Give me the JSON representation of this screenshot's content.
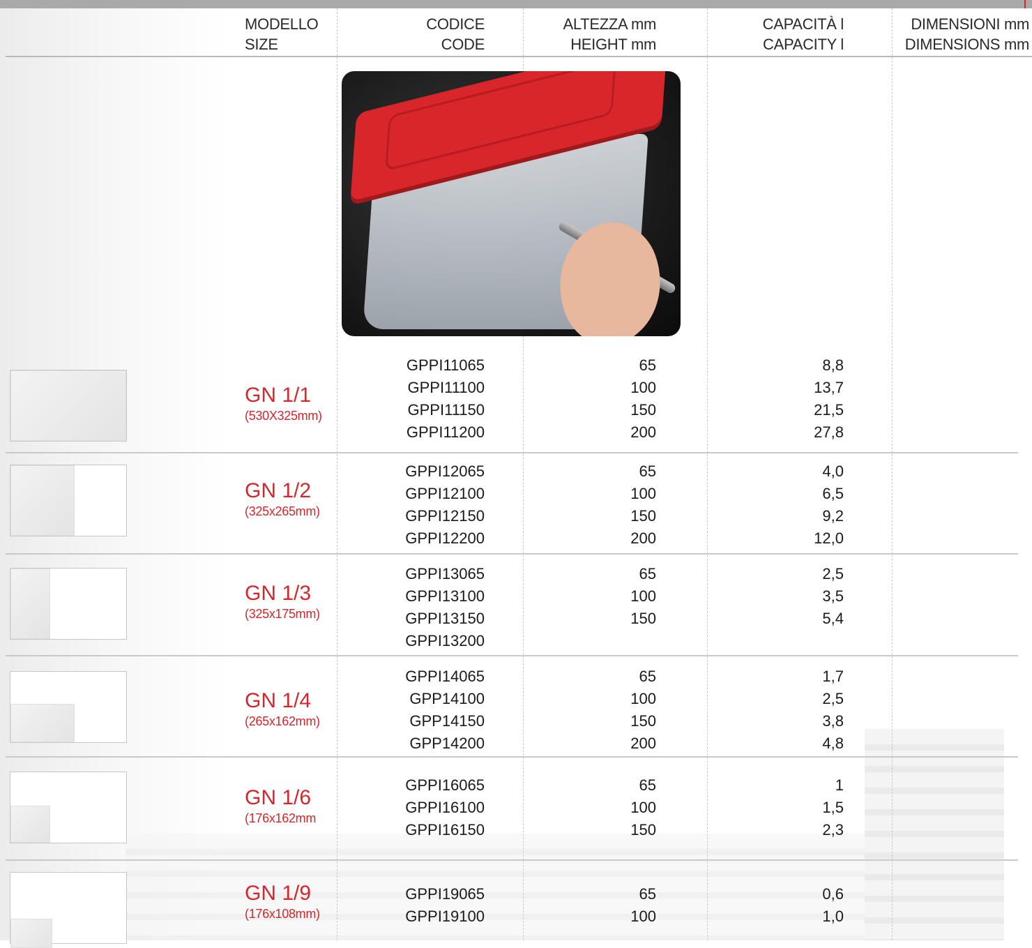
{
  "header": {
    "model": [
      "MODELLO",
      "SIZE"
    ],
    "code": [
      "CODICE",
      "CODE"
    ],
    "height": [
      "ALTEZZA mm",
      "HEIGHT mm"
    ],
    "capacity": [
      "CAPACITÀ l",
      "CAPACITY l"
    ],
    "dimensions": [
      "DIMENSIONI mm",
      "DIMENSIONS mm"
    ]
  },
  "rows": [
    {
      "name": "GN 1/1",
      "dim": "(530X325mm)",
      "codes": [
        "GPPI11065",
        "GPPI11100",
        "GPPI11150",
        "GPPI11200"
      ],
      "heights": [
        "65",
        "100",
        "150",
        "200"
      ],
      "capacities": [
        "8,8",
        "13,7",
        "21,5",
        "27,8"
      ]
    },
    {
      "name": "GN 1/2",
      "dim": "(325x265mm)",
      "codes": [
        "GPPI12065",
        "GPPI12100",
        "GPPI12150",
        "GPPI12200"
      ],
      "heights": [
        "65",
        "100",
        "150",
        "200"
      ],
      "capacities": [
        "4,0",
        "6,5",
        "9,2",
        "12,0"
      ]
    },
    {
      "name": "GN 1/3",
      "dim": "(325x175mm)",
      "codes": [
        "GPPI13065",
        "GPPI13100",
        "GPPI13150",
        "GPPI13200"
      ],
      "heights": [
        "65",
        "100",
        "150",
        ""
      ],
      "capacities": [
        "2,5",
        "3,5",
        "5,4",
        ""
      ]
    },
    {
      "name": "GN 1/4",
      "dim": "(265x162mm)",
      "codes": [
        "GPPI14065",
        " GPP14100",
        " GPP14150",
        " GPP14200"
      ],
      "heights": [
        "65",
        "100",
        "150",
        "200"
      ],
      "capacities": [
        "1,7",
        "2,5",
        "3,8",
        "4,8"
      ]
    },
    {
      "name": "GN 1/6",
      "dim": "(176x162mm",
      "codes": [
        "GPPI16065",
        "GPPI16100",
        "GPPI16150"
      ],
      "heights": [
        "65",
        "100",
        "150"
      ],
      "capacities": [
        "1",
        "1,5",
        "2,3"
      ]
    },
    {
      "name": "GN 1/9",
      "dim": "(176x108mm)",
      "codes": [
        "GPPI19065",
        "GPPI19100"
      ],
      "heights": [
        "65",
        "100"
      ],
      "capacities": [
        "0,6",
        "1,0"
      ]
    }
  ]
}
